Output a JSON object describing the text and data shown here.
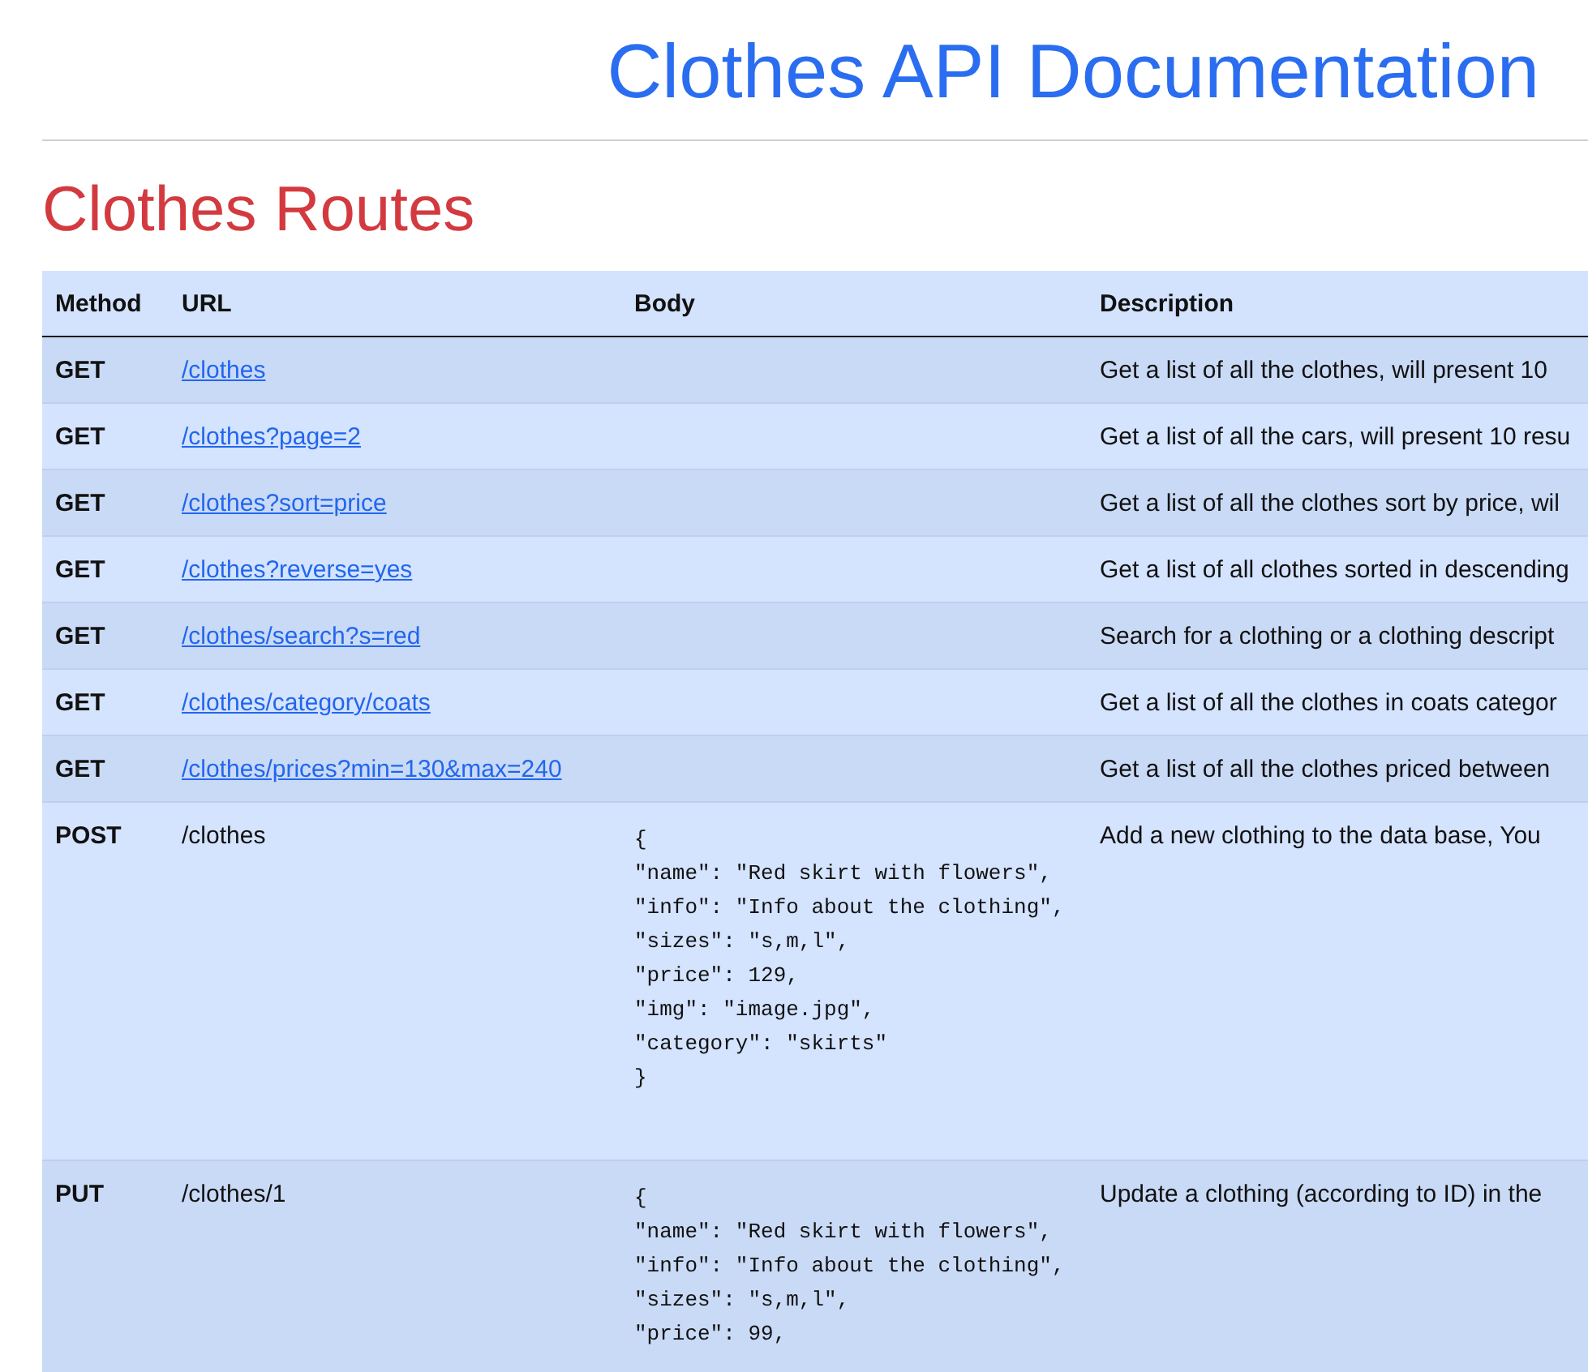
{
  "page_title": "Clothes API Documentation",
  "section_title": "Clothes Routes",
  "table": {
    "columns": [
      "Method",
      "URL",
      "Body",
      "Description"
    ],
    "rows": [
      {
        "method": "GET",
        "kind": "link",
        "url": "/clothes",
        "body": [],
        "description": "Get a list of all the clothes, will present 10"
      },
      {
        "method": "GET",
        "kind": "link",
        "url": "/clothes?page=2",
        "body": [],
        "description": "Get a list of all the cars, will present 10 resu"
      },
      {
        "method": "GET",
        "kind": "link",
        "url": "/clothes?sort=price",
        "body": [],
        "description": "Get a list of all the clothes sort by price, wil"
      },
      {
        "method": "GET",
        "kind": "link",
        "url": "/clothes?reverse=yes",
        "body": [],
        "description": "Get a list of all clothes sorted in descending"
      },
      {
        "method": "GET",
        "kind": "link",
        "url": "/clothes/search?s=red",
        "body": [],
        "description": "Search for a clothing or a clothing descript"
      },
      {
        "method": "GET",
        "kind": "link",
        "url": "/clothes/category/coats",
        "body": [],
        "description": "Get a list of all the clothes in coats categor"
      },
      {
        "method": "GET",
        "kind": "link",
        "url": "/clothes/prices?min=130&max=240",
        "body": [],
        "description": "Get a list of all the clothes priced between"
      },
      {
        "method": "POST",
        "kind": "plain",
        "url": "/clothes",
        "body": [
          "{",
          "\"name\": \"Red skirt with flowers\",",
          "\"info\": \"Info about the clothing\",",
          "\"sizes\": \"s,m,l\",",
          "\"price\": 129,",
          "\"img\": \"image.jpg\",",
          "\"category\": \"skirts\"",
          "}"
        ],
        "description": "Add a new clothing to the data base, You"
      },
      {
        "method": "PUT",
        "kind": "plain",
        "url": "/clothes/1",
        "body": [
          "{",
          "\"name\": \"Red skirt with flowers\",",
          "\"info\": \"Info about the clothing\",",
          "\"sizes\": \"s,m,l\",",
          "\"price\": 99,"
        ],
        "description": "Update a clothing (according to ID) in the"
      }
    ]
  }
}
